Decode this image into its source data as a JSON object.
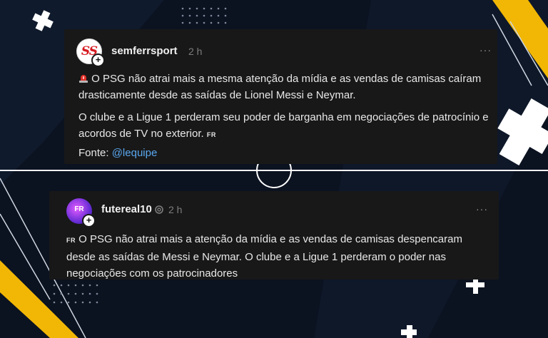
{
  "post1": {
    "username": "semferrsport",
    "time": "2 h",
    "avatar_initials": "SS",
    "paragraph1": "O PSG não atrai mais a mesma atenção da mídia e as vendas de camisas caíram drasticamente desde as saídas de Lionel Messi e Neymar.",
    "paragraph2": "O clube e a Ligue 1 perderam seu poder de barganha em negociações de patrocínio e acordos de TV no exterior.",
    "flag": "FR",
    "source_label": "Fonte:",
    "source_link": "@lequipe",
    "more": "···",
    "follow": "+"
  },
  "post2": {
    "username": "futereal10",
    "time": "2 h",
    "avatar_initials": "FR",
    "flag": "FR",
    "text": "O PSG não atrai mais a atenção da mídia e as vendas de camisas despencaram desde as saídas de Messi e Neymar. O clube e a Ligue 1 perderam o poder nas negociações com os patrocinadores",
    "more": "···",
    "follow": "+"
  },
  "colors": {
    "background": "#0b1220",
    "card": "#181818",
    "accent_yellow": "#f2b705",
    "link": "#5aa7ef"
  },
  "icons": [
    "siren-emoji",
    "threads-icon",
    "more-icon",
    "plus-icon",
    "cross-decoration"
  ]
}
